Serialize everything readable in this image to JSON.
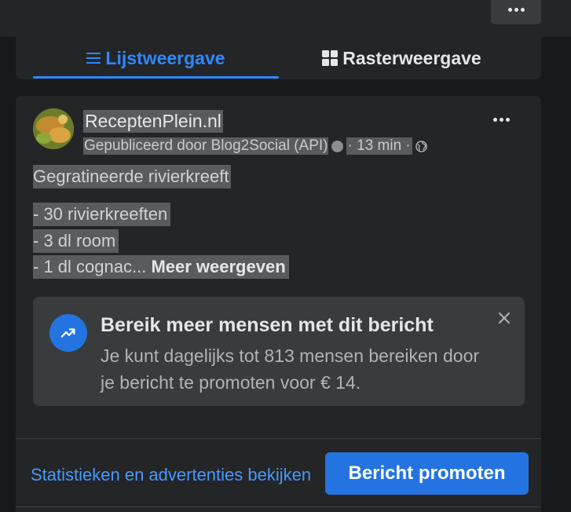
{
  "tabs": {
    "list_label": "Lijstweergave",
    "grid_label": "Rasterweergave"
  },
  "post": {
    "page_name": "ReceptenPlein.nl",
    "published_by": "Gepubliceerd door Blog2Social (API)",
    "time": "· 13 min ·",
    "title": "Gegratineerde rivierkreeft",
    "lines": [
      " - 30 rivierkreeften",
      "- 3 dl room",
      "- 1 dl cognac..."
    ],
    "see_more": "Meer weergeven"
  },
  "promo": {
    "title": "Bereik meer mensen met dit bericht",
    "text": "Je kunt dagelijks tot 813 mensen bereiken door je bericht te promoten voor € 14."
  },
  "footer": {
    "stats_link": "Statistieken en advertenties bekijken",
    "promote_button": "Bericht promoten"
  },
  "colors": {
    "accent": "#2d88ff",
    "button": "#2374e1",
    "card": "#242526",
    "background": "#18191a"
  },
  "icons": {
    "list_tab": "list-icon",
    "grid_tab": "grid-icon",
    "promo": "trending-up-icon",
    "audience": "globe-icon"
  }
}
